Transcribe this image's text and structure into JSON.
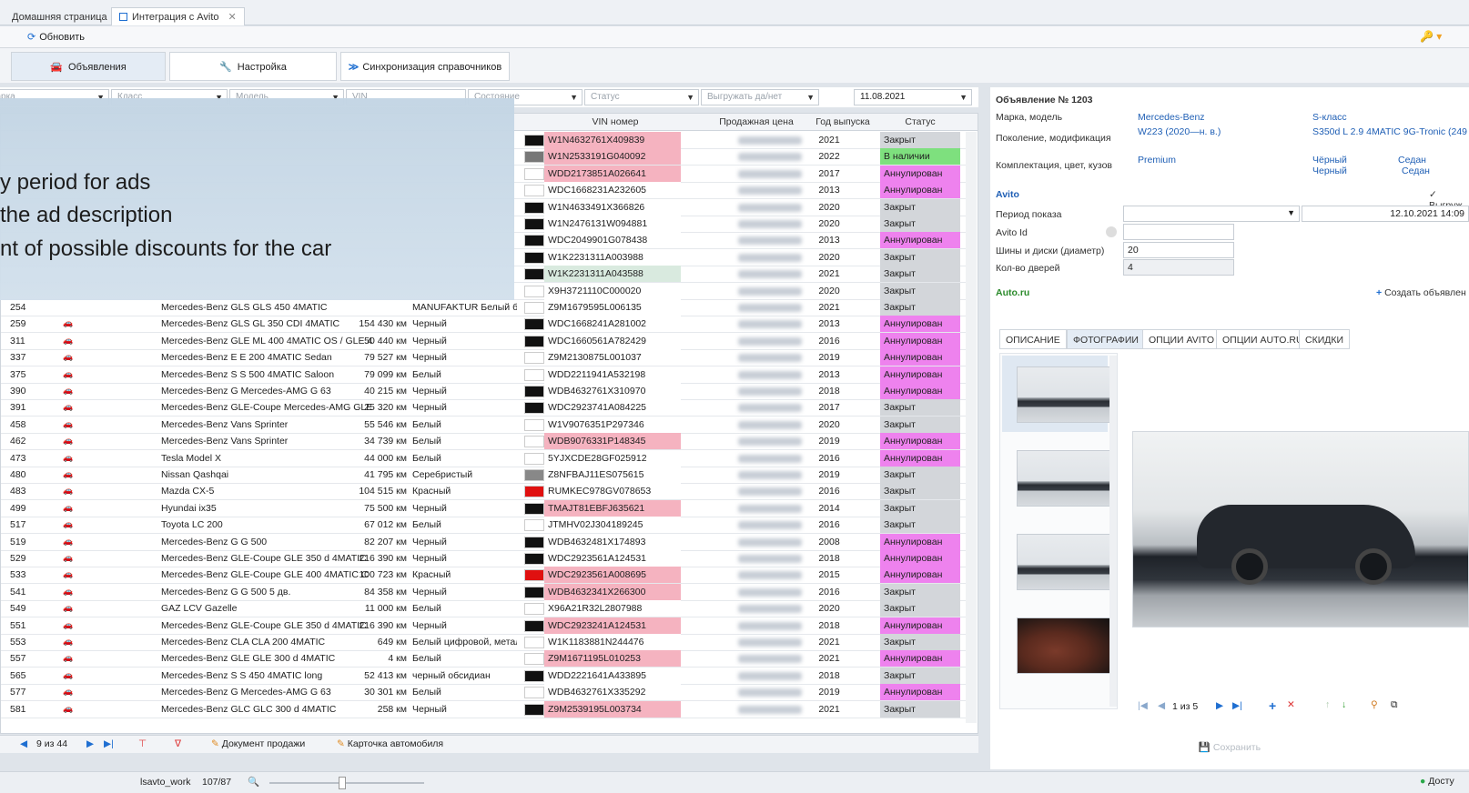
{
  "doc_tabs": [
    "Домашняя страница",
    "Интеграция с Avito"
  ],
  "toolbar": {
    "refresh": "Обновить"
  },
  "mode_tabs": [
    "Объявления",
    "Настройка",
    "Синхронизация справочников"
  ],
  "filters": {
    "brand": "Марка",
    "class": "Класс",
    "model": "Модель",
    "vin": "VIN",
    "state": "Состояние",
    "status": "Статус",
    "export": "Выгружать да/нет",
    "date": "11.08.2021"
  },
  "grid": {
    "headers": {
      "vin": "VIN номер",
      "price": "Продажная цена",
      "year": "Год выпуска",
      "status": "Статус"
    },
    "top_rows": [
      {
        "vin": "W1N4632761X409839",
        "year": "2021",
        "status": "Закрыт",
        "vin_bg": "#f5b3c0",
        "status_bg": "#d3d6da",
        "swatch": "#111111"
      },
      {
        "vin": "W1N2533191G040092",
        "year": "2022",
        "status": "В наличии",
        "vin_bg": "#f5b3c0",
        "status_bg": "#7ee07e",
        "swatch": "#777777"
      },
      {
        "vin": "WDD2173851A026641",
        "year": "2017",
        "status": "Аннулирован",
        "vin_bg": "#f5b3c0",
        "status_bg": "#ee82ee",
        "swatch": "#ffffff"
      },
      {
        "vin": "WDC1668231A232605",
        "year": "2013",
        "status": "Аннулирован",
        "vin_bg": "#ffffff",
        "status_bg": "#ee82ee",
        "swatch": "#ffffff"
      },
      {
        "vin": "W1N4633491X366826",
        "year": "2020",
        "status": "Закрыт",
        "vin_bg": "#ffffff",
        "status_bg": "#d3d6da",
        "swatch": "#111111"
      },
      {
        "vin": "W1N2476131W094881",
        "year": "2020",
        "status": "Закрыт",
        "vin_bg": "#ffffff",
        "status_bg": "#d3d6da",
        "swatch": "#111111"
      },
      {
        "vin": "WDC2049901G078438",
        "year": "2013",
        "status": "Аннулирован",
        "vin_bg": "#ffffff",
        "status_bg": "#ee82ee",
        "swatch": "#111111"
      },
      {
        "vin": "W1K2231311A003988",
        "year": "2020",
        "status": "Закрыт",
        "vin_bg": "#ffffff",
        "status_bg": "#d3d6da",
        "swatch": "#111111"
      },
      {
        "vin": "W1K2231311A043588",
        "year": "2021",
        "status": "Закрыт",
        "vin_bg": "#d9eadf",
        "status_bg": "#d3d6da",
        "swatch": "#111111"
      },
      {
        "vin": "X9H3721110C000020",
        "year": "2020",
        "status": "Закрыт",
        "vin_bg": "#ffffff",
        "status_bg": "#d3d6da",
        "swatch": "#ffffff"
      }
    ],
    "rows": [
      {
        "id": "254",
        "car": false,
        "ok": true,
        "st": "no",
        "model": "Mercedes-Benz GLS GLS 450 4MATIC",
        "km": "",
        "color": "MANUFAKTUR Белый бри",
        "swatch": "#ffffff",
        "vin": "Z9M1679595L006135",
        "vin_bg": "#ffffff",
        "year": "2021",
        "status": "Закрыт",
        "status_bg": "#d3d6da"
      },
      {
        "id": "259",
        "car": true,
        "ok": true,
        "st": "ok",
        "model": "Mercedes-Benz GLS GL 350 CDI 4MATIC",
        "km": "154 430 км",
        "color": "Черный",
        "swatch": "#111111",
        "vin": "WDC1668241A281002",
        "vin_bg": "#ffffff",
        "year": "2013",
        "status": "Аннулирован",
        "status_bg": "#ee82ee"
      },
      {
        "id": "311",
        "car": true,
        "ok": false,
        "st": "no",
        "model": "Mercedes-Benz GLE ML 400 4MATIC OS / GLE 4",
        "km": "50 440 км",
        "color": "Черный",
        "swatch": "#111111",
        "vin": "WDC1660561A782429",
        "vin_bg": "#ffffff",
        "year": "2016",
        "status": "Аннулирован",
        "status_bg": "#ee82ee"
      },
      {
        "id": "337",
        "car": true,
        "ok": false,
        "st": "no",
        "model": "Mercedes-Benz E E 200 4MATIC Sedan",
        "km": "79 527 км",
        "color": "Черный",
        "swatch": "#ffffff",
        "vin": "Z9M2130875L001037",
        "vin_bg": "#ffffff",
        "year": "2019",
        "status": "Аннулирован",
        "status_bg": "#ee82ee"
      },
      {
        "id": "375",
        "car": true,
        "ok": false,
        "st": "no",
        "model": "Mercedes-Benz S S 500 4MATIC Saloon",
        "km": "79 099 км",
        "color": "Белый",
        "swatch": "#ffffff",
        "vin": "WDD2211941A532198",
        "vin_bg": "#ffffff",
        "year": "2013",
        "status": "Аннулирован",
        "status_bg": "#ee82ee"
      },
      {
        "id": "390",
        "car": true,
        "ok": false,
        "st": "no",
        "model": "Mercedes-Benz G Mercedes-AMG G 63",
        "km": "40 215 км",
        "color": "Черный",
        "swatch": "#111111",
        "vin": "WDB4632761X310970",
        "vin_bg": "#ffffff",
        "year": "2018",
        "status": "Аннулирован",
        "status_bg": "#ee82ee"
      },
      {
        "id": "391",
        "car": true,
        "ok": true,
        "st": "no",
        "model": "Mercedes-Benz GLE-Coupe Mercedes-AMG GLE",
        "km": "25 320 км",
        "color": "Черный",
        "swatch": "#111111",
        "vin": "WDC2923741A084225",
        "vin_bg": "#ffffff",
        "year": "2017",
        "status": "Закрыт",
        "status_bg": "#d3d6da"
      },
      {
        "id": "458",
        "car": true,
        "ok": false,
        "st": "grey",
        "model": "Mercedes-Benz Vans Sprinter",
        "km": "55 546 км",
        "color": "Белый",
        "swatch": "#ffffff",
        "vin": "W1V9076351P297346",
        "vin_bg": "#ffffff",
        "year": "2020",
        "status": "Закрыт",
        "status_bg": "#d3d6da"
      },
      {
        "id": "462",
        "car": true,
        "ok": true,
        "st": "ok",
        "model": "Mercedes-Benz Vans Sprinter",
        "km": "34 739 км",
        "color": "Белый",
        "swatch": "#ffffff",
        "vin": "WDB9076331P148345",
        "vin_bg": "#f5b3c0",
        "year": "2019",
        "status": "Аннулирован",
        "status_bg": "#ee82ee"
      },
      {
        "id": "473",
        "car": true,
        "ok": true,
        "st": "grey",
        "model": "Tesla Model X",
        "km": "44 000 км",
        "color": "Белый",
        "swatch": "#ffffff",
        "vin": "5YJXCDE28GF025912",
        "vin_bg": "#ffffff",
        "year": "2016",
        "status": "Аннулирован",
        "status_bg": "#ee82ee"
      },
      {
        "id": "480",
        "car": true,
        "ok": true,
        "st": "grey",
        "model": "Nissan Qashqai",
        "km": "41 795 км",
        "color": "Серебристый",
        "swatch": "#888888",
        "vin": "Z8NFBAJ11ES075615",
        "vin_bg": "#ffffff",
        "year": "2019",
        "status": "Закрыт",
        "status_bg": "#d3d6da"
      },
      {
        "id": "483",
        "car": true,
        "ok": true,
        "st": "grey",
        "model": "Mazda CX-5",
        "km": "104 515 км",
        "color": "Красный",
        "swatch": "#e01010",
        "vin": "RUMKEC978GV078653",
        "vin_bg": "#ffffff",
        "year": "2016",
        "status": "Закрыт",
        "status_bg": "#d3d6da"
      },
      {
        "id": "499",
        "car": true,
        "ok": true,
        "st": "grey",
        "model": "Hyundai ix35",
        "km": "75 500 км",
        "color": "Черный",
        "swatch": "#111111",
        "vin": "TMAJT81EBFJ635621",
        "vin_bg": "#f5b3c0",
        "year": "2014",
        "status": "Закрыт",
        "status_bg": "#d3d6da"
      },
      {
        "id": "517",
        "car": true,
        "ok": true,
        "st": "grey",
        "model": "Toyota LC 200",
        "km": "67 012 км",
        "color": "Белый",
        "swatch": "#ffffff",
        "vin": "JTMHV02J304189245",
        "vin_bg": "#ffffff",
        "year": "2016",
        "status": "Закрыт",
        "status_bg": "#d3d6da"
      },
      {
        "id": "519",
        "car": true,
        "ok": true,
        "st": "grey",
        "model": "Mercedes-Benz G G 500",
        "km": "82 207 км",
        "color": "Черный",
        "swatch": "#111111",
        "vin": "WDB4632481X174893",
        "vin_bg": "#ffffff",
        "year": "2008",
        "status": "Аннулирован",
        "status_bg": "#ee82ee"
      },
      {
        "id": "529",
        "car": true,
        "ok": true,
        "st": "grey",
        "model": "Mercedes-Benz GLE-Coupe GLE 350 d 4MATIC",
        "km": "216 390 км",
        "color": "Черный",
        "swatch": "#111111",
        "vin": "WDC2923561A124531",
        "vin_bg": "#ffffff",
        "year": "2018",
        "status": "Аннулирован",
        "status_bg": "#ee82ee"
      },
      {
        "id": "533",
        "car": true,
        "ok": true,
        "st": "grey",
        "model": "Mercedes-Benz GLE-Coupe GLE 400 4MATIC C",
        "km": "100 723 км",
        "color": "Красный",
        "swatch": "#e01010",
        "vin": "WDC2923561A008695",
        "vin_bg": "#f5b3c0",
        "year": "2015",
        "status": "Аннулирован",
        "status_bg": "#ee82ee"
      },
      {
        "id": "541",
        "car": true,
        "ok": true,
        "st": "grey",
        "model": "Mercedes-Benz G G 500 5 дв.",
        "km": "84 358 км",
        "color": "Черный",
        "swatch": "#111111",
        "vin": "WDB4632341X266300",
        "vin_bg": "#f5b3c0",
        "year": "2016",
        "status": "Закрыт",
        "status_bg": "#d3d6da"
      },
      {
        "id": "549",
        "car": true,
        "ok": true,
        "st": "grey",
        "model": "GAZ LCV Gazelle",
        "km": "11 000 км",
        "color": "Белый",
        "swatch": "#ffffff",
        "vin": "X96A21R32L2807988",
        "vin_bg": "#ffffff",
        "year": "2020",
        "status": "Закрыт",
        "status_bg": "#d3d6da"
      },
      {
        "id": "551",
        "car": true,
        "ok": true,
        "st": "no",
        "model": "Mercedes-Benz GLE-Coupe GLE 350 d 4MATIC",
        "km": "216 390 км",
        "color": "Черный",
        "swatch": "#111111",
        "vin": "WDC2923241A124531",
        "vin_bg": "#f5b3c0",
        "year": "2018",
        "status": "Аннулирован",
        "status_bg": "#ee82ee"
      },
      {
        "id": "553",
        "car": true,
        "ok": true,
        "st": "grey",
        "model": "Mercedes-Benz CLA CLA 200 4MATIC",
        "km": "649 км",
        "color": "Белый цифровой, метал",
        "swatch": "#ffffff",
        "vin": "W1K1183881N244476",
        "vin_bg": "#ffffff",
        "year": "2021",
        "status": "Закрыт",
        "status_bg": "#d3d6da"
      },
      {
        "id": "557",
        "car": true,
        "ok": true,
        "st": "grey",
        "model": "Mercedes-Benz GLE GLE 300 d 4MATIC",
        "km": "4 км",
        "color": "Белый",
        "swatch": "#ffffff",
        "vin": "Z9M1671195L010253",
        "vin_bg": "#f5b3c0",
        "year": "2021",
        "status": "Аннулирован",
        "status_bg": "#ee82ee"
      },
      {
        "id": "565",
        "car": true,
        "ok": true,
        "st": "grey",
        "model": "Mercedes-Benz S S 450 4MATIC long",
        "km": "52 413 км",
        "color": "черный обсидиан",
        "swatch": "#111111",
        "vin": "WDD2221641A433895",
        "vin_bg": "#ffffff",
        "year": "2018",
        "status": "Закрыт",
        "status_bg": "#d3d6da"
      },
      {
        "id": "577",
        "car": true,
        "ok": true,
        "st": "grey",
        "model": "Mercedes-Benz G Mercedes-AMG G 63",
        "km": "30 301 км",
        "color": "Белый",
        "swatch": "#ffffff",
        "vin": "WDB4632761X335292",
        "vin_bg": "#ffffff",
        "year": "2019",
        "status": "Аннулирован",
        "status_bg": "#ee82ee"
      },
      {
        "id": "581",
        "car": true,
        "ok": true,
        "st": "grey",
        "model": "Mercedes-Benz GLC GLC 300 d 4MATIC",
        "km": "258 км",
        "color": "Черный",
        "swatch": "#111111",
        "vin": "Z9M2539195L003734",
        "vin_bg": "#f5b3c0",
        "year": "2021",
        "status": "Закрыт",
        "status_bg": "#d3d6da"
      }
    ],
    "footer": {
      "page": "9 из 44",
      "doc_btn": "Документ продажи",
      "card_btn": "Карточка автомобиля"
    }
  },
  "overlay": {
    "lines": [
      "y period for ads",
      "the ad description",
      "nt of possible discounts for the car"
    ]
  },
  "detail": {
    "title": "Объявление № 1203",
    "brand_label": "Марка, модель",
    "brand": "Mercedes-Benz",
    "model": "S-класс",
    "gen_label": "Поколение, модификация",
    "gen": "W223 (2020—н. в.)",
    "mod": "S350d L 2.9 4MATIC 9G-Tronic (249 л.",
    "equip_label": "Комплектация, цвет, кузов",
    "equip": "Premium",
    "color1": "Чёрный",
    "color2": "Черный",
    "body1": "Седан",
    "body2": "Седан",
    "avito": "Avito",
    "export": "Выгруж",
    "period_label": "Период показа",
    "period_date": "12.10.2021 14:09",
    "avito_id_label": "Avito Id",
    "tires_label": "Шины и диски (диаметр)",
    "tires": "20",
    "doors_label": "Кол-во дверей",
    "doors": "4",
    "autoru": "Auto.ru",
    "create": "Создать объявлен",
    "tabs": [
      "ОПИСАНИЕ",
      "ФОТОГРАФИИ",
      "ОПЦИИ AVITO",
      "ОПЦИИ AUTO.RU",
      "СКИДКИ"
    ],
    "pager": "1 из 5",
    "save": "Сохранить"
  },
  "status": {
    "user": "lsavto_work",
    "count": "107/87",
    "right": "Досту"
  }
}
